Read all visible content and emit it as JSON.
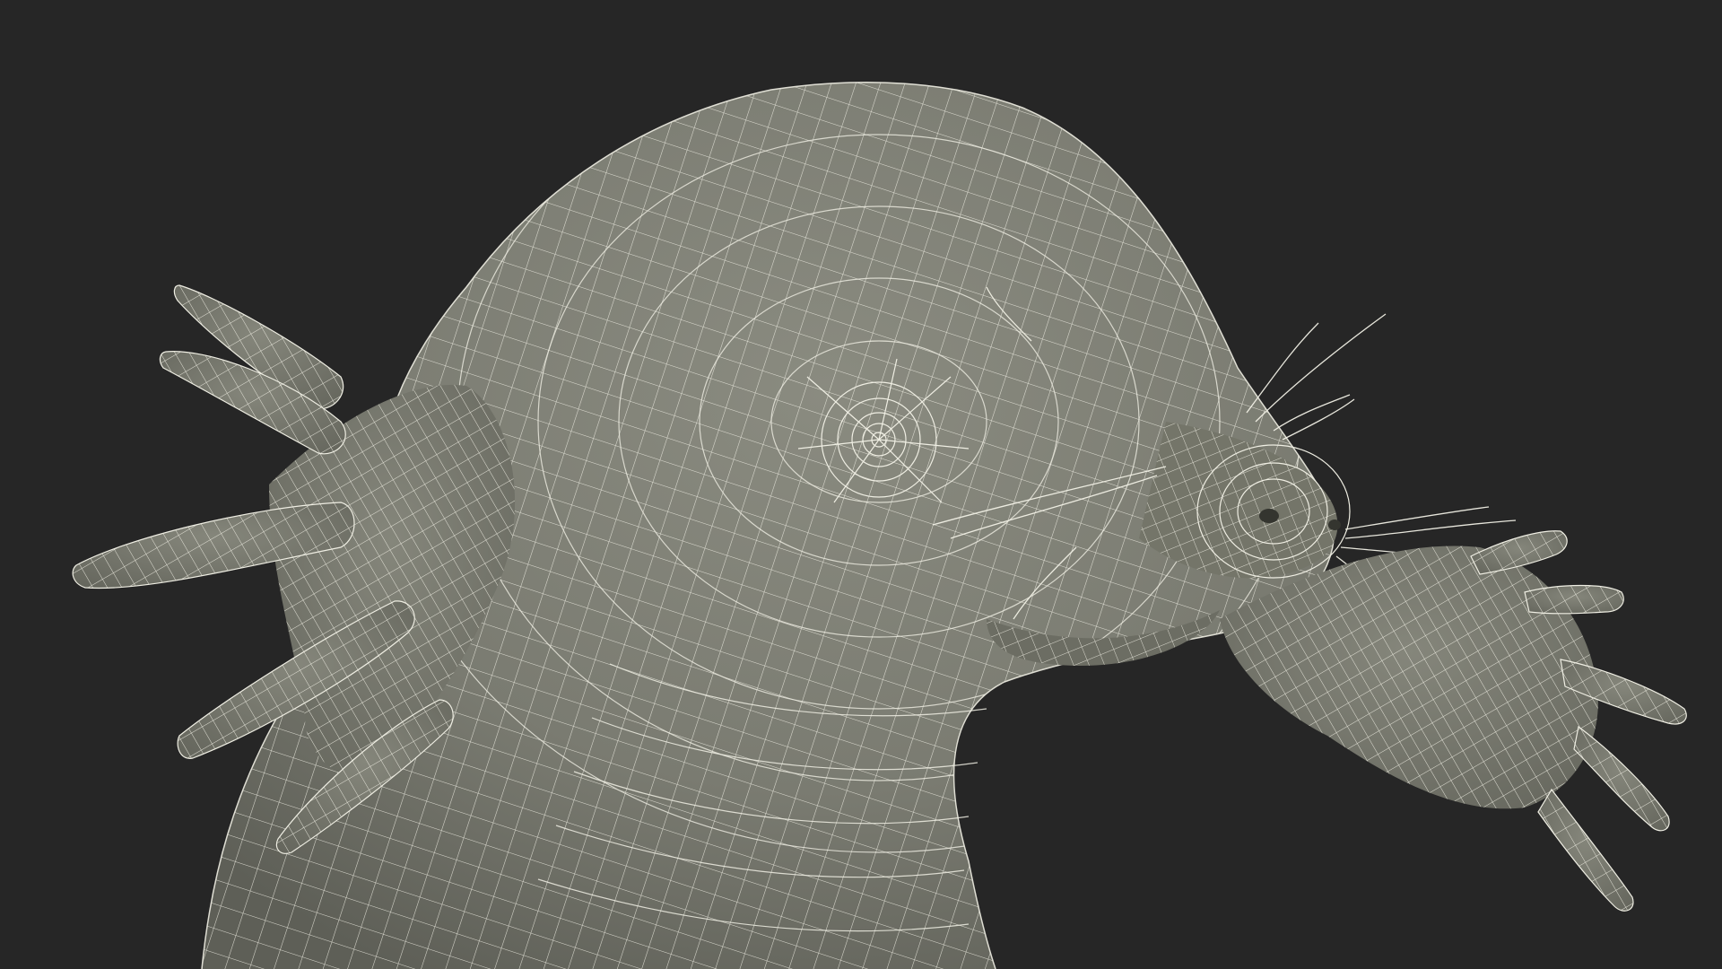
{
  "scene": {
    "subject": "mole-wireframe-model",
    "background_color": "#262626",
    "surface_color": "#7b7c72",
    "wire_color": "#efeee3",
    "shadow_color": "#5f6058"
  }
}
